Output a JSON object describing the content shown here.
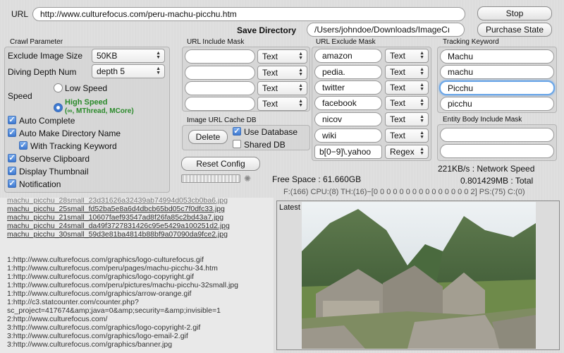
{
  "url": {
    "label": "URL",
    "value": "http://www.culturefocus.com/peru-machu-picchu.htm",
    "stop_label": "Stop"
  },
  "save_directory": {
    "label": "Save Directory",
    "value": "/Users/johndoe/Downloads/ImageCı",
    "purchase_label": "Purchase State"
  },
  "crawl": {
    "title": "Crawl Parameter",
    "exclude_size_label": "Exclude Image Size",
    "exclude_size_value": "50KB",
    "depth_label": "Diving Depth Num",
    "depth_value": "depth 5",
    "speed_label": "Speed",
    "low_speed": "Low Speed",
    "high_speed": "High Speed",
    "high_speed_note": "(∞, MThread, MCore)",
    "options": [
      {
        "label": "Auto Complete",
        "checked": true
      },
      {
        "label": "Auto Make Directory Name",
        "checked": true
      },
      {
        "label": "With Tracking Keyword",
        "checked": true
      },
      {
        "label": "Observe Clipboard",
        "checked": true
      },
      {
        "label": "Display Thumbnail",
        "checked": true
      },
      {
        "label": "Notification",
        "checked": true
      }
    ]
  },
  "include_mask": {
    "title": "URL Include Mask",
    "rows": [
      {
        "value": "",
        "type": "Text"
      },
      {
        "value": "",
        "type": "Text"
      },
      {
        "value": "",
        "type": "Text"
      },
      {
        "value": "",
        "type": "Text"
      }
    ]
  },
  "exclude_mask": {
    "title": "URL Exclude Mask",
    "rows": [
      {
        "value": "amazon",
        "type": "Text"
      },
      {
        "value": "pedia.",
        "type": "Text"
      },
      {
        "value": "twitter",
        "type": "Text"
      },
      {
        "value": "facebook",
        "type": "Text"
      },
      {
        "value": "nicov",
        "type": "Text"
      },
      {
        "value": "wiki",
        "type": "Text"
      },
      {
        "value": "b[0−9]\\.yahoo",
        "type": "Regex"
      }
    ]
  },
  "tracking": {
    "title": "Tracking Keyword",
    "keywords": [
      "Machu",
      "machu",
      "Picchu",
      "picchu"
    ]
  },
  "entity_mask": {
    "title": "Entity Body Include Mask",
    "rows": [
      "",
      ""
    ]
  },
  "cache_db": {
    "title": "Image URL Cache DB",
    "delete_label": "Delete",
    "use_database": "Use Database",
    "shared_db": "Shared DB"
  },
  "reset_label": "Reset Config",
  "status": {
    "free_space": "Free Space : 61.660GB",
    "network_speed": "221KB/s : Network Speed",
    "total": "0.801429MB : Total",
    "threads": "F:(166) CPU:(8) TH:(16)−[0 0 0 0 0 0 0 0 0 0 0 0 0 0 0 2] PS:(75) C:(0)"
  },
  "downloaded": [
    "machu_picchu_25small_fd52ba5e8a6d4dbcb65bd05c7f0dfc33.jpg",
    "machu_picchu_21small_10607faef93547ad8f26fa85c2bd43a7.jpg",
    "machu_picchu_24small_da49f3727831426c95e5429a100251d2.jpg",
    "machu_picchu_30small_59d3e81ba4814b88bf9a07090da9fce2.jpg"
  ],
  "downloaded_partial": "machu_picchu_28small_23d31626a32439ab74994d053cb0ba6.jpg",
  "links": [
    "1:http://www.culturefocus.com/graphics/logo-culturefocus.gif",
    "1:http://www.culturefocus.com/peru/pages/machu-picchu-34.htm",
    "1:http://www.culturefocus.com/graphics/logo-copyright.gif",
    "1:http://www.culturefocus.com/peru/pictures/machu-picchu-32small.jpg",
    "1:http://www.culturefocus.com/graphics/arrow-orange.gif",
    "1:http://c3.statcounter.com/counter.php?",
    "sc_project=417674&amp;java=0&amp;security=&amp;invisible=1",
    "2:http://www.culturefocus.com/",
    "3:http://www.culturefocus.com/graphics/logo-copyright-2.gif",
    "3:http://www.culturefocus.com/graphics/logo-email-2.gif",
    "3:http://www.culturefocus.com/graphics/banner.jpg"
  ],
  "latest_label": "Latest"
}
